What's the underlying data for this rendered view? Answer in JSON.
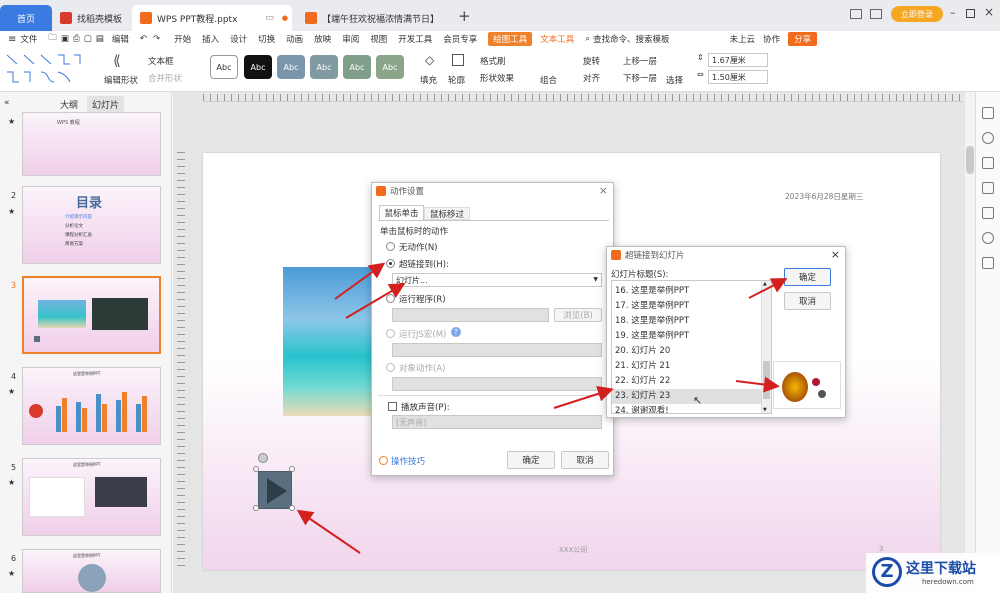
{
  "colors": {
    "accent": "#f26b1d",
    "wps_red": "#d83b2b",
    "tab_blue": "#3b7ae0",
    "arrow_red": "#d41f1f",
    "drawing_tool_bg": "#f0812b"
  },
  "tabs": [
    {
      "label": "首页",
      "icon": "home-icon"
    },
    {
      "label": "找稻壳模板",
      "icon": "docer-icon"
    },
    {
      "label": "WPS PPT教程.pptx",
      "icon": "ppt-icon"
    },
    {
      "label": "【端午狂欢祝福浓情满节日】",
      "icon": "ppt-icon"
    }
  ],
  "window": {
    "login": "立即登录"
  },
  "menubar": {
    "file": "文件",
    "edit": "编辑",
    "items": [
      "开始",
      "插入",
      "设计",
      "切换",
      "动画",
      "放映",
      "审阅",
      "视图",
      "开发工具",
      "会员专享"
    ],
    "drawing_tools": "绘图工具",
    "text_tools": "文本工具",
    "search": "查找命令、搜索模板",
    "cloud": "未上云",
    "collab": "协作",
    "share": "分享"
  },
  "ribbon": {
    "edit_shape": "编辑形状",
    "textbox": "文本框",
    "merge_shape": "合并形状",
    "style_labels": [
      "Abc",
      "Abc",
      "Abc",
      "Abc",
      "Abc",
      "Abc"
    ],
    "fill": "填充",
    "outline": "轮廓",
    "format_painter": "格式刷",
    "shape_effects": "形状效果",
    "group": "组合",
    "rotate": "旋转",
    "align": "对齐",
    "bring_forward": "上移一层",
    "send_backward": "下移一层",
    "select": "选择",
    "height": "1.67厘米",
    "width": "1.50厘米"
  },
  "leftpanel": {
    "tab_outline": "大纲",
    "tab_slides": "幻灯片",
    "slides": [
      {
        "num": "",
        "title": "WPS 教程"
      },
      {
        "num": "2",
        "title": "目录",
        "items": [
          "介绍演示内容",
          "分析论文",
          "课程分析汇总",
          "简易方案"
        ]
      },
      {
        "num": "3",
        "title": ""
      },
      {
        "num": "4",
        "title": "这里是举例PPT"
      },
      {
        "num": "5",
        "title": "这里是举例PPT"
      },
      {
        "num": "6",
        "title": "这里是举例PPT"
      }
    ]
  },
  "slide": {
    "date": "2023年6月28日星期三",
    "company": "XXX公司",
    "page": "3"
  },
  "action_dialog": {
    "title": "动作设置",
    "tabs": [
      "鼠标单击",
      "鼠标移过"
    ],
    "group": "单击鼠标时的动作",
    "options": {
      "none": "无动作(N)",
      "hyperlink": "超链接到(H):",
      "hyperlink_value": "幻灯片...",
      "run_program": "运行程序(R)",
      "browse": "浏览(B)",
      "run_js": "运行JS宏(M)",
      "object_action": "对象动作(A)",
      "play_sound": "播放声音(P):",
      "sound_value": "[无声音]"
    },
    "tips": "操作技巧",
    "ok": "确定",
    "cancel": "取消"
  },
  "link_dialog": {
    "title": "超链接到幻灯片",
    "list_label": "幻灯片标题(S):",
    "items": [
      "16. 这里是举例PPT",
      "17. 这里是举例PPT",
      "18. 这里是举例PPT",
      "19. 这里是举例PPT",
      "20. 幻灯片 20",
      "21. 幻灯片 21",
      "22. 幻灯片 22",
      "23. 幻灯片 23",
      "24. 谢谢观看!"
    ],
    "selected_index": 7,
    "ok": "确定",
    "cancel": "取消"
  },
  "watermark": {
    "text": "这里下载站",
    "url": "heredown.com"
  }
}
